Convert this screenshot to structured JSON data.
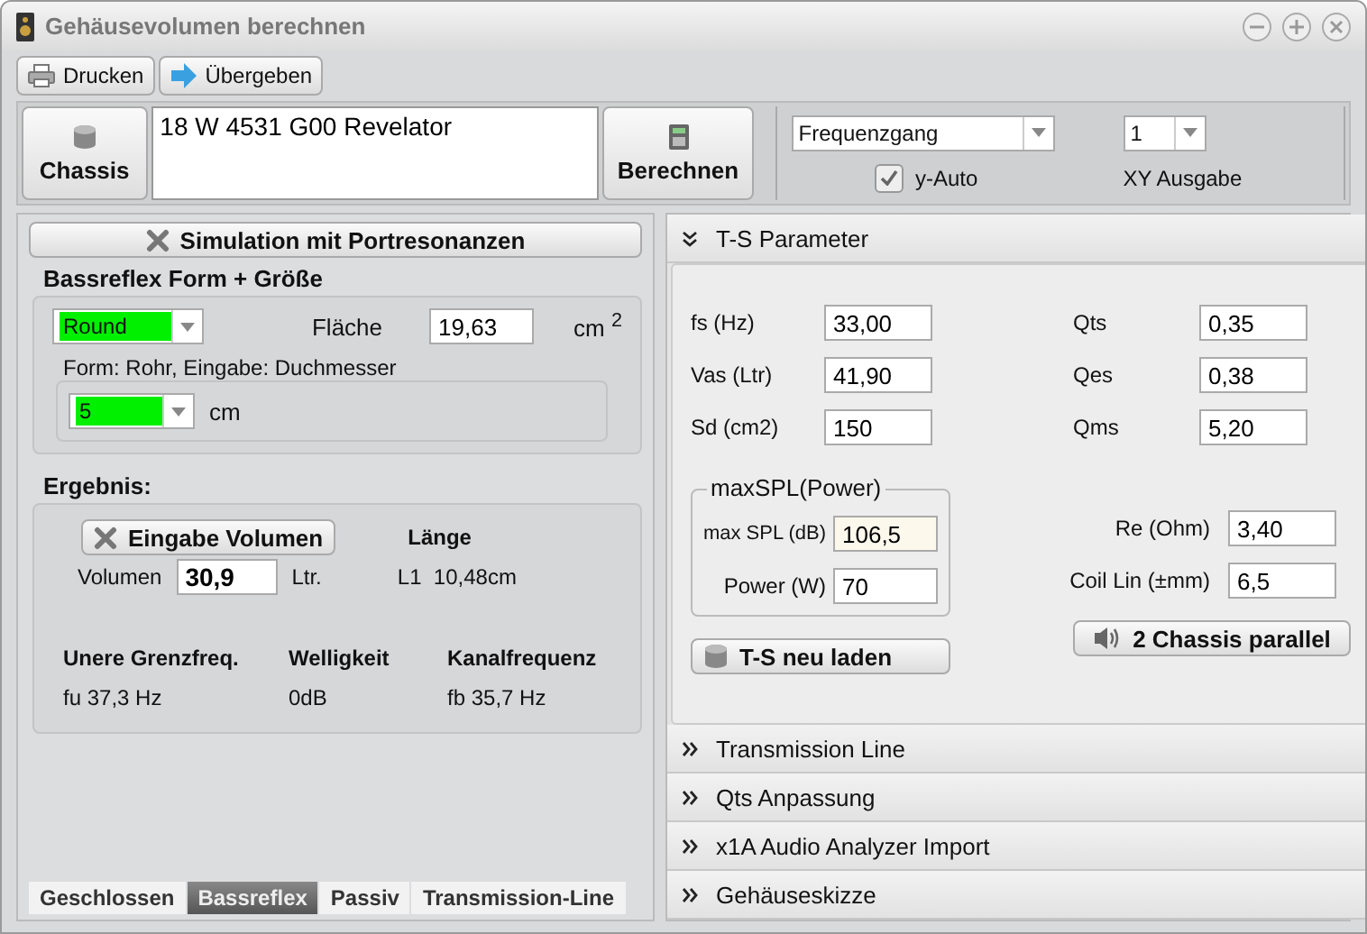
{
  "window": {
    "title": "Gehäusevolumen berechnen"
  },
  "toolbar": [
    {
      "label": "Drucken"
    },
    {
      "label": "Übergeben"
    }
  ],
  "chassis": {
    "button": "Chassis",
    "name": "18 W 4531 G00 Revelator",
    "calc_button": "Berechnen"
  },
  "output": {
    "mode": "Frequenzgang",
    "y_auto": {
      "label": "y-Auto",
      "checked": true
    },
    "xy_value": "1",
    "xy_label": "XY Ausgabe"
  },
  "left": {
    "simulation_button": "Simulation mit Portresonanzen",
    "bassreflex": {
      "title": "Bassreflex Form + Größe",
      "shape": "Round",
      "area_label": "Fläche",
      "area": "19,63",
      "area_unit": "cm $^{2}$",
      "form_title": "Form: Rohr, Eingabe: Duchmesser",
      "diameter": "5",
      "diameter_unit": "cm"
    },
    "result": {
      "title": "Ergebnis:",
      "volume_button": "Eingabe Volumen",
      "volume_label": "Volumen",
      "volume": "30,9",
      "volume_unit": "Ltr.",
      "length_title": "Länge",
      "length_symbol": "L1",
      "length": "10,48cm",
      "metrics": [
        {
          "title": "Unere Grenzfreq.",
          "symbol": "fu",
          "value": "37,3 Hz"
        },
        {
          "title": "Welligkeit",
          "value": "0dB"
        },
        {
          "title": "Kanalfrequenz",
          "symbol": "fb",
          "value": "35,7 Hz"
        }
      ]
    }
  },
  "tabs": [
    {
      "label": "Geschlossen",
      "selected": false
    },
    {
      "label": "Bassreflex",
      "selected": true
    },
    {
      "label": "Passiv",
      "selected": false
    },
    {
      "label": "Transmission-Line",
      "selected": false
    }
  ],
  "accordion": [
    {
      "title": "T-S Parameter",
      "expanded": true
    },
    {
      "title": "Transmission Line",
      "expanded": false
    },
    {
      "title": "Qts Anpassung",
      "expanded": false
    },
    {
      "title": "x1A Audio Analyzer Import",
      "expanded": false
    },
    {
      "title": "Gehäuseskizze",
      "expanded": false
    }
  ],
  "ts": {
    "left": [
      {
        "label": "fs (Hz)",
        "value": "33,00"
      },
      {
        "label": "Vas (Ltr)",
        "value": "41,90"
      },
      {
        "label": "Sd (cm2)",
        "value": "150"
      }
    ],
    "right": [
      {
        "label": "Qts",
        "value": "0,35"
      },
      {
        "label": "Qes",
        "value": "0,38"
      },
      {
        "label": "Qms",
        "value": "5,20"
      }
    ],
    "maxspl": {
      "title": "maxSPL(Power)",
      "fields": [
        {
          "label": "max SPL (dB)",
          "value": "106,5"
        },
        {
          "label": "Power (W)",
          "value": "70"
        }
      ]
    },
    "right_lower": [
      {
        "label": "Re (Ohm)",
        "value": "3,40"
      },
      {
        "label": "Coil Lin (±mm)",
        "value": "6,5"
      }
    ],
    "reload_button": "T-S neu laden",
    "parallel_button": "2 Chassis parallel"
  }
}
